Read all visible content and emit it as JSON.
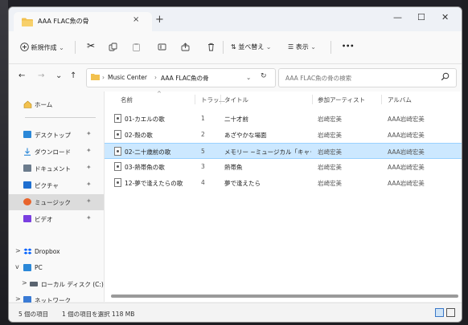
{
  "window": {
    "tab_title": "AAA FLAC魚の骨",
    "tab_close": "×",
    "new_tab": "+",
    "minimize": "—",
    "maximize": "☐",
    "close": "✕"
  },
  "toolbar": {
    "new_label": "新規作成",
    "sort_label": "並べ替え",
    "view_label": "表示",
    "more_label": "•••"
  },
  "address": {
    "breadcrumbs": [
      "Music Center",
      "AAA FLAC魚の骨"
    ],
    "search_placeholder": "AAA FLAC魚の骨の検索"
  },
  "sidebar": {
    "home": "ホーム",
    "quick": [
      {
        "label": "デスクトップ",
        "color": "#2b88d8"
      },
      {
        "label": "ダウンロード",
        "color": "#2b88d8"
      },
      {
        "label": "ドキュメント",
        "color": "#6b7b8c"
      },
      {
        "label": "ピクチャ",
        "color": "#1e6fd0"
      },
      {
        "label": "ミュージック",
        "color": "#e8642c"
      },
      {
        "label": "ビデオ",
        "color": "#7a3fe0"
      }
    ],
    "tree": [
      {
        "label": "Dropbox",
        "chevron": ">"
      },
      {
        "label": "PC",
        "chevron": "v"
      },
      {
        "label": "ローカル ディスク (C:)",
        "chevron": ">"
      },
      {
        "label": "ネットワーク",
        "chevron": ">"
      }
    ]
  },
  "columns": [
    "名前",
    "トラッ...",
    "タイトル",
    "参加アーティスト",
    "アルバム"
  ],
  "files": [
    {
      "name": "01-カエルの歌",
      "track": "1",
      "title": "二十才前",
      "artist": "岩崎宏美",
      "album": "AAA岩崎宏美"
    },
    {
      "name": "02-殻の歌",
      "track": "2",
      "title": "あざやかな場面",
      "artist": "岩崎宏美",
      "album": "AAA岩崎宏美"
    },
    {
      "name": "02-二十歳前の歌",
      "track": "5",
      "title": "メモリー ~ミュージカル「キャッツ」より",
      "artist": "岩崎宏美",
      "album": "AAA岩崎宏美",
      "selected": true
    },
    {
      "name": "03-熱帯魚の歌",
      "track": "3",
      "title": "熱帯魚",
      "artist": "岩崎宏美",
      "album": "AAA岩崎宏美"
    },
    {
      "name": "12-夢で逢えたらの歌",
      "track": "4",
      "title": "夢で逢えたら",
      "artist": "岩崎宏美",
      "album": "AAA岩崎宏美"
    }
  ],
  "status": {
    "count": "5 個の項目",
    "selection": "1 個の項目を選択  118 MB"
  }
}
